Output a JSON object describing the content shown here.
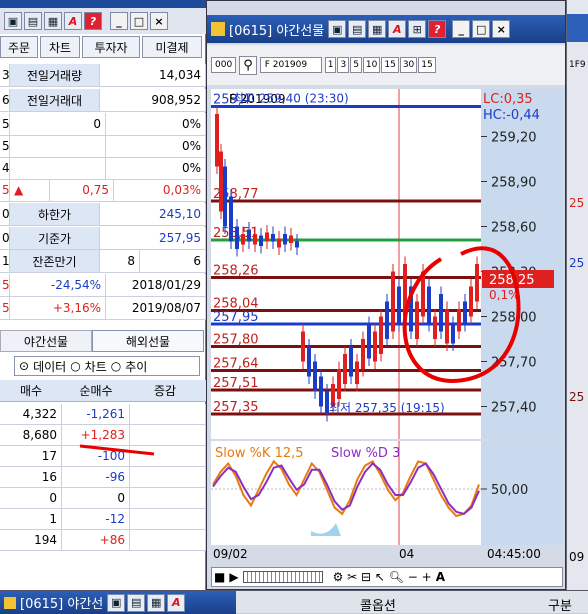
{
  "left_window": {
    "toolbar_icons": [
      "window-icon",
      "copy-icon",
      "print-icon",
      "font-icon",
      "help-icon"
    ],
    "win_controls": [
      "_",
      "□",
      "×"
    ],
    "tabs": [
      "주문",
      "차트",
      "투자자",
      "미결제"
    ],
    "info_rows": [
      {
        "label": "전일거래량",
        "value": "14,034"
      },
      {
        "label": "전일거래대",
        "value": "908,952"
      },
      {
        "mid": "0",
        "right": "0%"
      },
      {
        "right": "0%"
      },
      {
        "right": "0%"
      },
      {
        "arrow": "▲",
        "mid": "0,75",
        "right": "0,03%"
      },
      {
        "label": "하한가",
        "value": "245,10"
      },
      {
        "label": "기준가",
        "value": "257,95"
      },
      {
        "label": "잔존만기",
        "mid": "8",
        "value": "6"
      },
      {
        "mid": "-24,54%",
        "value": "2018/01/29"
      },
      {
        "mid": "+3,16%",
        "value": "2019/08/07"
      }
    ],
    "left_row_marks": [
      "3",
      "6",
      "5",
      "5",
      "4",
      "5",
      "0",
      "0",
      "1",
      "5",
      "5"
    ],
    "lower_tabs": [
      "야간선물",
      "해외선물"
    ],
    "radio_options": [
      "데이터",
      "차트",
      "추이"
    ],
    "table_headers": [
      "매수",
      "순매수",
      "증감"
    ],
    "table_rows": [
      [
        "4,322",
        "-1,261",
        ""
      ],
      [
        "8,680",
        "+1,283",
        ""
      ],
      [
        "17",
        "-100",
        ""
      ],
      [
        "16",
        "-96",
        ""
      ],
      [
        "0",
        "0",
        ""
      ],
      [
        "1",
        "-12",
        ""
      ],
      [
        "194",
        "+86",
        ""
      ]
    ]
  },
  "chart_window": {
    "title": "[0615] 야간선물",
    "toolbar": {
      "interval_value": "000",
      "code_label": "F 201909"
    },
    "toolbar_chips": [
      "1",
      "3",
      "5",
      "10",
      "15",
      "30",
      "15"
    ],
    "price_chart": {
      "legend": "F 201909",
      "high_label": "최고 259,40 (23:30)",
      "low_label": "최저 257,35 (19:15)",
      "lc_label": "LC:0,35",
      "hc_label": "HC:-0,44",
      "current_price": "258,25",
      "current_pct": "0,1%",
      "yaxis": [
        "259,20",
        "258,90",
        "258,60",
        "258,30",
        "258,00",
        "257,70",
        "257,40"
      ],
      "level_labels": [
        "259,4",
        "258,77",
        "258,51",
        "258,26",
        "258,04",
        "257,95",
        "257,80",
        "257,64",
        "257,51",
        "257,35"
      ]
    },
    "stoch": {
      "k_label": "Slow %K 12,5",
      "d_label": "Slow %D 3",
      "yaxis": [
        "50,00"
      ]
    },
    "xaxis": {
      "left": "09/02",
      "mid": "04",
      "right": "04:45:00"
    },
    "bottom_controls": [
      "■",
      "▶",
      "A"
    ]
  },
  "bottom_bar": {
    "title": "[0615] 야간선",
    "center_label": "콜옵션",
    "right_label": "구분"
  },
  "right_edge": {
    "labels": [
      "1F9",
      "25",
      "25",
      "25",
      "09"
    ]
  },
  "colors": {
    "title_bg": "#2b5fb8",
    "panel_label_bg": "#dde6f4",
    "chart_bg": "#ffffff",
    "up": "#e0201e",
    "down": "#1b3cc8",
    "level": "#7a1010",
    "ma": "#20a040",
    "annotation": "#e80000"
  }
}
